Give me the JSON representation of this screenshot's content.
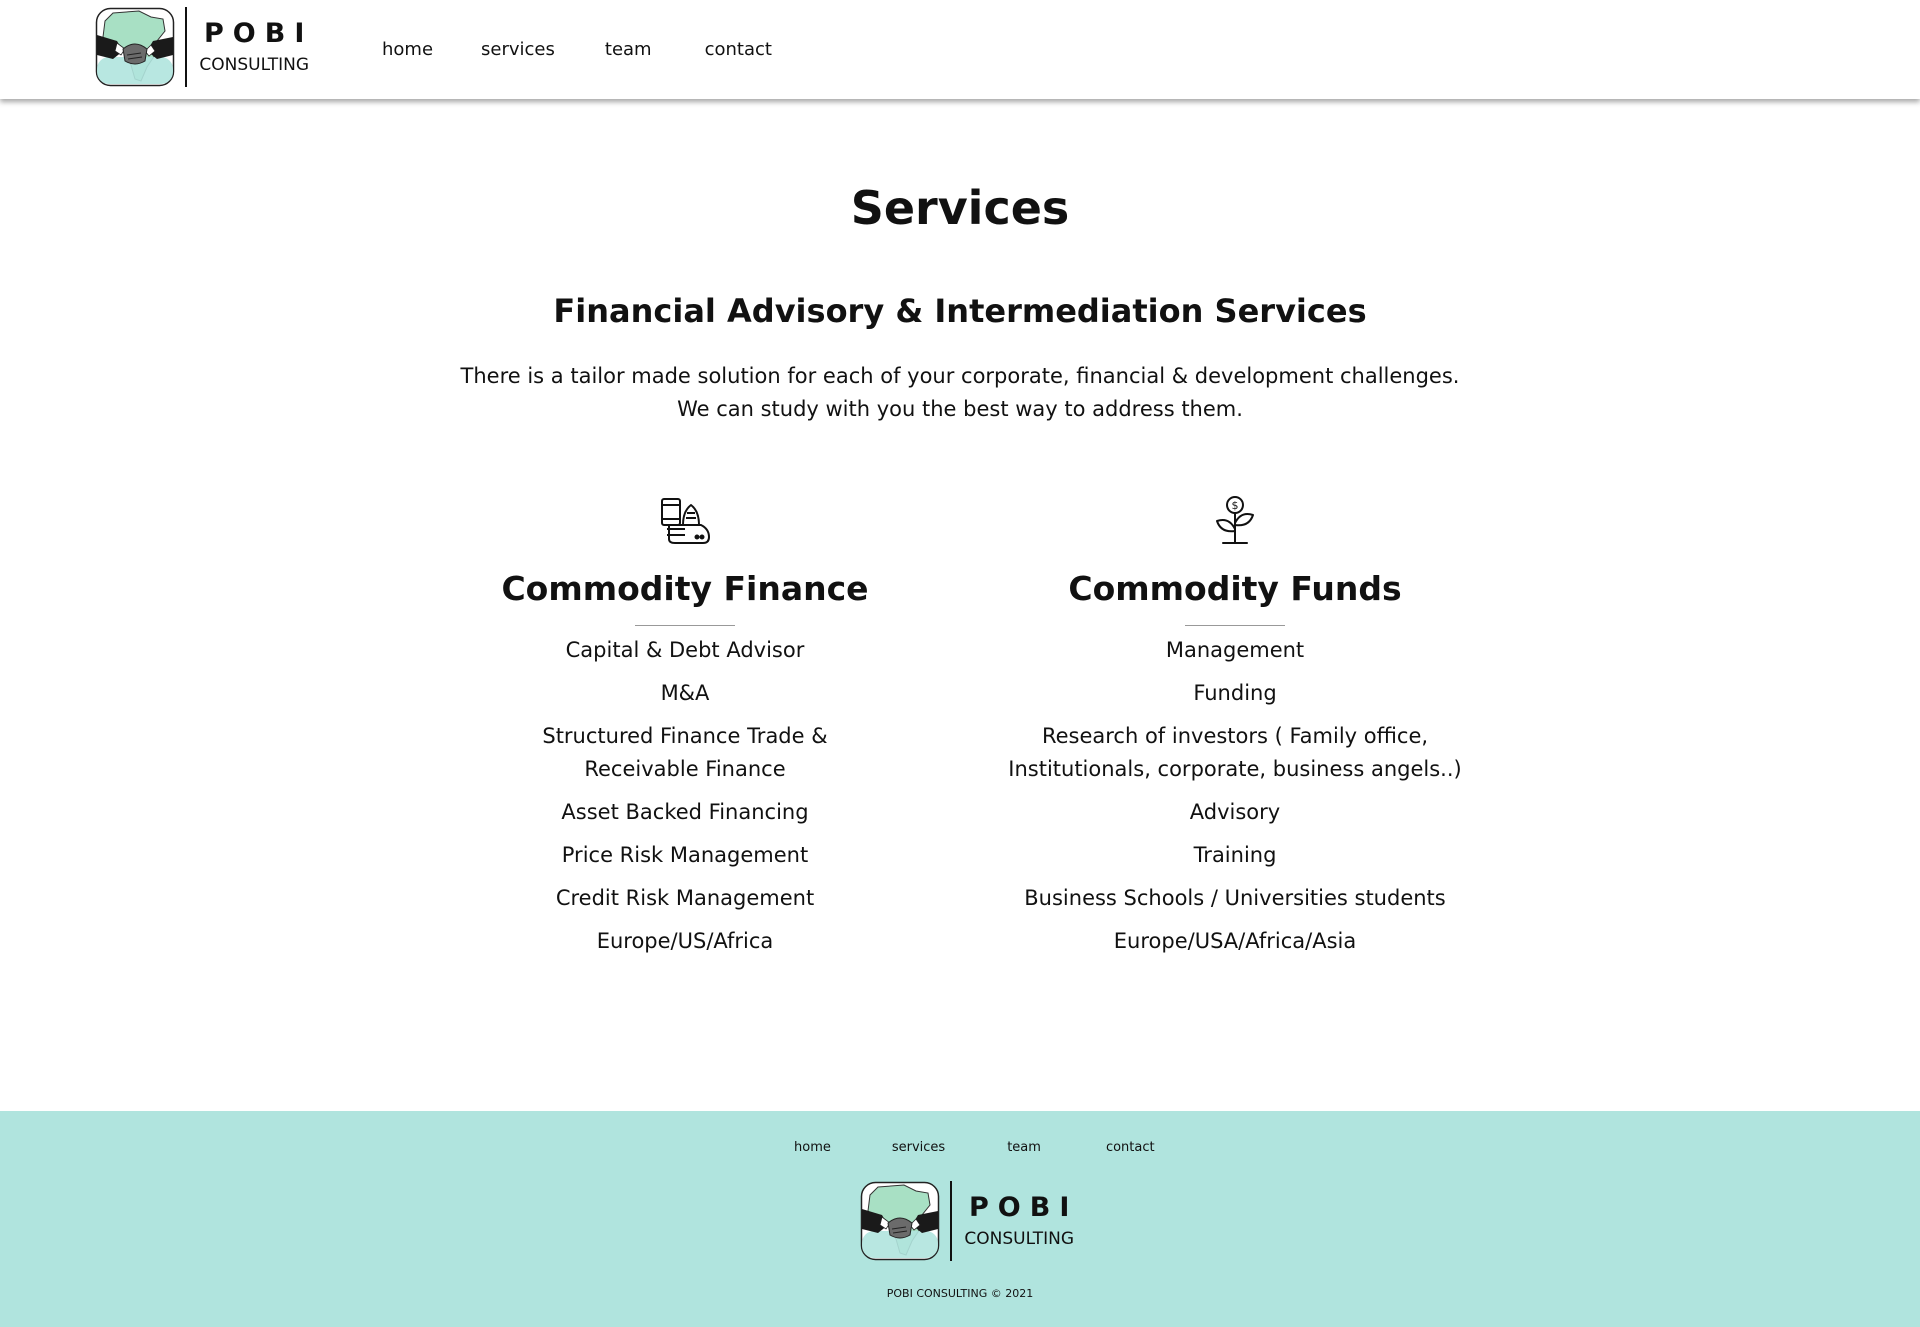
{
  "brand": {
    "name": "POBI",
    "tagline": "CONSULTING",
    "colors": {
      "accent": "#b0e4de",
      "text": "#111111",
      "logo_green": "#a8e0c4"
    }
  },
  "nav": {
    "items": [
      {
        "label": "home"
      },
      {
        "label": "services"
      },
      {
        "label": "team"
      },
      {
        "label": "contact"
      }
    ]
  },
  "main": {
    "title": "Services",
    "subtitle": "Financial Advisory & Intermediation Services",
    "intro_lines": [
      "There is a tailor made solution for each of your corporate, financial & development challenges.",
      "We can study with you the best way to address them."
    ],
    "columns": [
      {
        "icon": "commodities-icon",
        "title": "Commodity Finance",
        "items": [
          "Capital & Debt Advisor",
          "M&A",
          "Structured Finance Trade & Receivable Finance",
          "Asset Backed Financing",
          "Price Risk Management",
          "Credit Risk Management",
          "Europe/US/Africa"
        ]
      },
      {
        "icon": "money-plant-icon",
        "title": "Commodity Funds",
        "items": [
          "Management",
          "Funding",
          "Research of investors ( Family office, Institutionals, corporate, business angels..)",
          "Advisory",
          "Training",
          "Business Schools / Universities students",
          "Europe/USA/Africa/Asia"
        ]
      }
    ]
  },
  "footer": {
    "nav": [
      {
        "label": "home"
      },
      {
        "label": "services"
      },
      {
        "label": "team"
      },
      {
        "label": "contact"
      }
    ],
    "copyright": "POBI CONSULTING © 2021"
  }
}
